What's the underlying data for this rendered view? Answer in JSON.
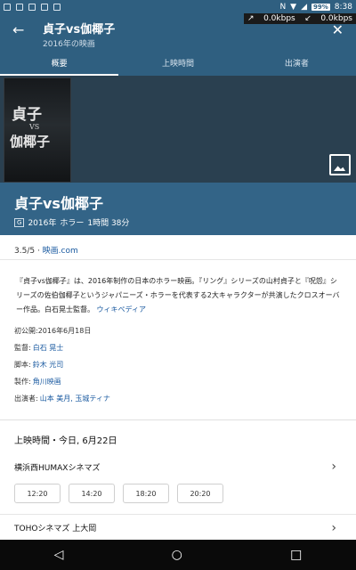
{
  "status_bar": {
    "time": "8:38",
    "battery": "99%"
  },
  "net_speed": {
    "up": "0.0kbps",
    "down": "0.0kbps"
  },
  "app_bar": {
    "back_glyph": "←",
    "title": "貞子vs伽椰子",
    "subtitle": "2016年の映画",
    "close_glyph": "✕"
  },
  "tabs": [
    {
      "label": "概要",
      "active": true
    },
    {
      "label": "上映時間",
      "active": false
    },
    {
      "label": "出演者",
      "active": false
    }
  ],
  "poster": {
    "title_line1": "貞子",
    "title_vs": "VS",
    "title_line2": "伽椰子"
  },
  "movie": {
    "title": "貞子vs伽椰子",
    "rating_badge": "G",
    "year": "2016年",
    "genre": "ホラー",
    "runtime": "1時間 38分"
  },
  "rating": {
    "score": "3.5/5",
    "source": "映画.com"
  },
  "description": {
    "text": "『貞子vs伽椰子』は、2016年制作の日本のホラー映画。『リング』シリーズの山村貞子と『呪怨』シリーズの佐伯伽椰子というジャパニーズ・ホラーを代表する2大キャラクターが共演したクロスオーバー作品。白石晃士監督。",
    "link": "ウィキペディア"
  },
  "facts": [
    {
      "label": "初公開:",
      "value": "2016年6月18日",
      "is_link": false
    },
    {
      "label": "監督:",
      "value": "白石 晃士",
      "is_link": true
    },
    {
      "label": "脚本:",
      "value": "鈴木 光司",
      "is_link": true
    },
    {
      "label": "製作:",
      "value": "角川映画",
      "is_link": true
    },
    {
      "label": "出演者:",
      "value": "山本 美月, 玉城ティナ",
      "is_link": true
    }
  ],
  "showtimes": {
    "header": "上映時間・今日, 6月22日",
    "theaters": [
      {
        "name": "横浜西HUMAXシネマズ",
        "times": [
          "12:20",
          "14:20",
          "18:20",
          "20:20"
        ]
      },
      {
        "name": "TOHOシネマズ 上大岡",
        "times": []
      }
    ]
  },
  "nav_bar": {
    "back": "◁",
    "home": "○",
    "recents": "□"
  },
  "colors": {
    "primary": "#2f5f80",
    "title_band": "#336487",
    "link": "#1a5aa0",
    "nav": "#0a0a0a"
  }
}
